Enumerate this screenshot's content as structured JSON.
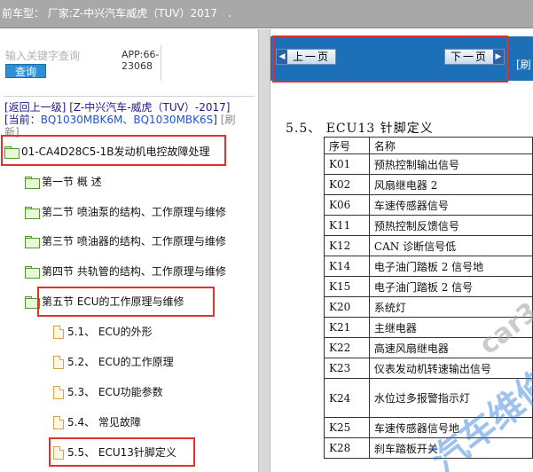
{
  "topbar": {
    "title": "前车型：  厂家:Z-中兴汽车威虎（TUV）2017",
    "trailing": "."
  },
  "left": {
    "search_placeholder": "输入关键字查询",
    "search_button": "查询",
    "app_code": "APP:66-\n23068",
    "back_link": "[返回上一级]",
    "back_path": "[Z-中兴汽车-威虎（TUV）-2017]",
    "current_label": "[当前：",
    "current_models": "BQ1030MBK6M、BQ1030MBK6S",
    "current_end": "]",
    "refresh_a": "[刷",
    "refresh_b": "新]",
    "tree": [
      {
        "label": "01-CA4D28C5-1B发动机电控故障处理",
        "type": "folder"
      },
      {
        "label": "第一节 概 述",
        "type": "folder"
      },
      {
        "label": "第二节 喷油泵的结构、工作原理与维修",
        "type": "folder"
      },
      {
        "label": "第三节 喷油器的结构、工作原理与维修",
        "type": "folder"
      },
      {
        "label": "第四节 共轨管的结构、工作原理与维修",
        "type": "folder"
      },
      {
        "label": "第五节 ECU的工作原理与维修",
        "type": "folder"
      },
      {
        "label": "5.1、 ECU的外形",
        "type": "doc"
      },
      {
        "label": "5.2、 ECU的工作原理",
        "type": "doc"
      },
      {
        "label": "5.3、 ECU功能参数",
        "type": "doc"
      },
      {
        "label": "5.4、 常见故障",
        "type": "doc"
      },
      {
        "label": "5.5、 ECU13针脚定义",
        "type": "doc"
      }
    ]
  },
  "right": {
    "prev_button": "上一页",
    "next_button": "下一页",
    "refresh": "[刷",
    "section_title": "5.5、    ECU13 针脚定义",
    "table": {
      "headers": [
        "序号",
        "名称"
      ],
      "rows": [
        [
          "K01",
          "预热控制输出信号"
        ],
        [
          "K02",
          "风扇继电器 2"
        ],
        [
          "K06",
          "车速传感器信号"
        ],
        [
          "K11",
          "预热控制反馈信号"
        ],
        [
          "K12",
          "CAN 诊断信号低"
        ],
        [
          "K14",
          "电子油门踏板 2 信号地"
        ],
        [
          "K15",
          "电子油门踏板 2 信号"
        ],
        [
          "K20",
          "系统灯"
        ],
        [
          "K21",
          "主继电器"
        ],
        [
          "K22",
          "高速风扇继电器"
        ],
        [
          "K23",
          "仪表发动机转速输出信号"
        ],
        [
          "K24",
          "水位过多报警指示灯"
        ],
        [
          "K25",
          "车速传感器信号地"
        ],
        [
          "K28",
          "刹车踏板开关"
        ]
      ]
    },
    "watermark": [
      "car3",
      "汽车维修"
    ]
  },
  "colors": {
    "topbar": "#a8a8a8",
    "navbar": "#1d6fb8",
    "highlight": "#e03030",
    "search_button": "#2f8fd4"
  }
}
